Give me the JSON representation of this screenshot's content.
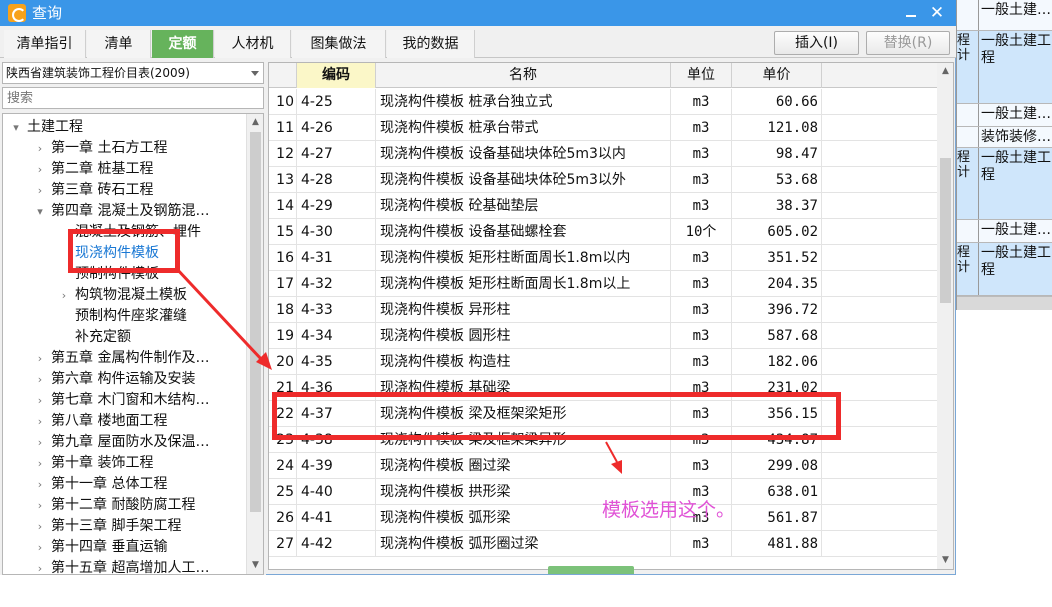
{
  "window": {
    "title": "查询"
  },
  "tabs": [
    {
      "label": "清单指引",
      "active": false
    },
    {
      "label": "清单",
      "active": false
    },
    {
      "label": "定额",
      "active": true
    },
    {
      "label": "人材机",
      "active": false
    },
    {
      "label": "图集做法",
      "active": false
    },
    {
      "label": "我的数据",
      "active": false
    }
  ],
  "toolbar": {
    "insert_label": "插入(I)",
    "replace_label": "替换(R)"
  },
  "library": {
    "selected": "陕西省建筑装饰工程价目表(2009)"
  },
  "search": {
    "placeholder": "搜索",
    "value": ""
  },
  "tree": [
    {
      "label": "土建工程",
      "expanded": true
    },
    {
      "label": "第一章  土石方工程"
    },
    {
      "label": "第二章  桩基工程"
    },
    {
      "label": "第三章  砖石工程"
    },
    {
      "label": "第四章  混凝土及钢筋混…",
      "expanded": true
    },
    {
      "label": "混凝土及钢筋、埋件"
    },
    {
      "label": "现浇构件模板",
      "selected": true
    },
    {
      "label": "预制构件模板"
    },
    {
      "label": "构筑物混凝土模板"
    },
    {
      "label": "预制构件座浆灌缝"
    },
    {
      "label": "补充定额"
    },
    {
      "label": "第五章  金属构件制作及…"
    },
    {
      "label": "第六章  构件运输及安装"
    },
    {
      "label": "第七章  木门窗和木结构…"
    },
    {
      "label": "第八章  楼地面工程"
    },
    {
      "label": "第九章  屋面防水及保温…"
    },
    {
      "label": "第十章  装饰工程"
    },
    {
      "label": "第十一章  总体工程"
    },
    {
      "label": "第十二章  耐酸防腐工程"
    },
    {
      "label": "第十三章  脚手架工程"
    },
    {
      "label": "第十四章  垂直运输"
    },
    {
      "label": "第十五章  超高增加人工…"
    }
  ],
  "grid": {
    "headers": {
      "code": "编码",
      "name": "名称",
      "unit": "单位",
      "price": "单价"
    },
    "rows": [
      {
        "idx": "10",
        "code": "4-25",
        "name": "现浇构件模板  桩承台独立式",
        "unit": "m3",
        "price": "60.66"
      },
      {
        "idx": "11",
        "code": "4-26",
        "name": "现浇构件模板  桩承台带式",
        "unit": "m3",
        "price": "121.08"
      },
      {
        "idx": "12",
        "code": "4-27",
        "name": "现浇构件模板  设备基础块体砼5m3以内",
        "unit": "m3",
        "price": "98.47"
      },
      {
        "idx": "13",
        "code": "4-28",
        "name": "现浇构件模板  设备基础块体砼5m3以外",
        "unit": "m3",
        "price": "53.68"
      },
      {
        "idx": "14",
        "code": "4-29",
        "name": "现浇构件模板  砼基础垫层",
        "unit": "m3",
        "price": "38.37"
      },
      {
        "idx": "15",
        "code": "4-30",
        "name": "现浇构件模板  设备基础螺栓套",
        "unit": "10个",
        "price": "605.02"
      },
      {
        "idx": "16",
        "code": "4-31",
        "name": "现浇构件模板  矩形柱断面周长1.8m以内",
        "unit": "m3",
        "price": "351.52"
      },
      {
        "idx": "17",
        "code": "4-32",
        "name": "现浇构件模板  矩形柱断面周长1.8m以上",
        "unit": "m3",
        "price": "204.35"
      },
      {
        "idx": "18",
        "code": "4-33",
        "name": "现浇构件模板  异形柱",
        "unit": "m3",
        "price": "396.72"
      },
      {
        "idx": "19",
        "code": "4-34",
        "name": "现浇构件模板  圆形柱",
        "unit": "m3",
        "price": "587.68"
      },
      {
        "idx": "20",
        "code": "4-35",
        "name": "现浇构件模板  构造柱",
        "unit": "m3",
        "price": "182.06"
      },
      {
        "idx": "21",
        "code": "4-36",
        "name": "现浇构件模板  基础梁",
        "unit": "m3",
        "price": "231.02"
      },
      {
        "idx": "22",
        "code": "4-37",
        "name": "现浇构件模板  梁及框架梁矩形",
        "unit": "m3",
        "price": "356.15"
      },
      {
        "idx": "23",
        "code": "4-38",
        "name": "现浇构件模板  梁及框架梁异形",
        "unit": "m3",
        "price": "434.87"
      },
      {
        "idx": "24",
        "code": "4-39",
        "name": "现浇构件模板  圈过梁",
        "unit": "m3",
        "price": "299.08"
      },
      {
        "idx": "25",
        "code": "4-40",
        "name": "现浇构件模板  拱形梁",
        "unit": "m3",
        "price": "638.01"
      },
      {
        "idx": "26",
        "code": "4-41",
        "name": "现浇构件模板  弧形梁",
        "unit": "m3",
        "price": "561.87"
      },
      {
        "idx": "27",
        "code": "4-42",
        "name": "现浇构件模板  弧形圈过梁",
        "unit": "m3",
        "price": "481.88"
      }
    ]
  },
  "annotation": {
    "text": "模板选用这个。",
    "color": "#e052d6",
    "box_color": "#ee2b2b"
  },
  "background_app": {
    "rows": [
      {
        "c1": "",
        "c2": "一般土建…"
      },
      {
        "c1": "程计",
        "c2": "一般土建工程"
      },
      {
        "c1": "",
        "c2": "一般土建…"
      },
      {
        "c1": "",
        "c2": "装饰装修…"
      },
      {
        "c1": "程计",
        "c2": "一般土建工程"
      },
      {
        "c1": "",
        "c2": "一般土建…"
      },
      {
        "c1": "程计",
        "c2": "一般土建工程"
      }
    ]
  }
}
